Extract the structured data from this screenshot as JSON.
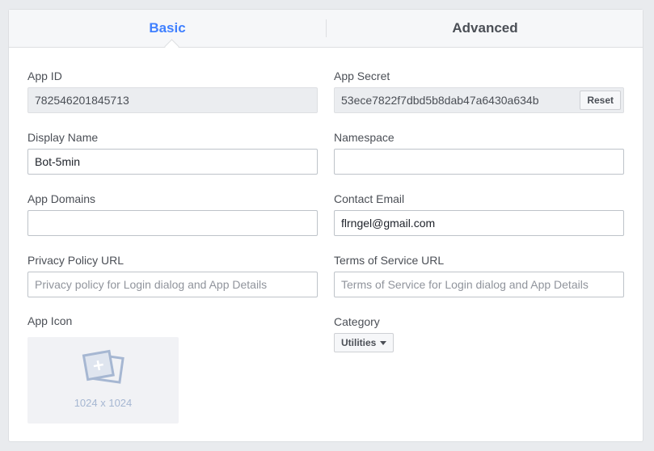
{
  "tabs": {
    "basic": "Basic",
    "advanced": "Advanced"
  },
  "form": {
    "app_id": {
      "label": "App ID",
      "value": "782546201845713"
    },
    "app_secret": {
      "label": "App Secret",
      "value": "53ece7822f7dbd5b8dab47a6430a634b",
      "reset_label": "Reset"
    },
    "display_name": {
      "label": "Display Name",
      "value": "Bot-5min"
    },
    "namespace": {
      "label": "Namespace",
      "value": ""
    },
    "app_domains": {
      "label": "App Domains",
      "value": ""
    },
    "contact_email": {
      "label": "Contact Email",
      "value": "flrngel@gmail.com"
    },
    "privacy_policy_url": {
      "label": "Privacy Policy URL",
      "value": "",
      "placeholder": "Privacy policy for Login dialog and App Details"
    },
    "terms_of_service_url": {
      "label": "Terms of Service URL",
      "value": "",
      "placeholder": "Terms of Service for Login dialog and App Details"
    },
    "app_icon": {
      "label": "App Icon",
      "dimensions": "1024 x 1024",
      "icon": "add-photo-icon"
    },
    "category": {
      "label": "Category",
      "selected": "Utilities"
    }
  },
  "colors": {
    "active_tab": "#4080ff",
    "inactive_tab": "#4b4f56",
    "icon_placeholder": "#a6b7d2"
  }
}
